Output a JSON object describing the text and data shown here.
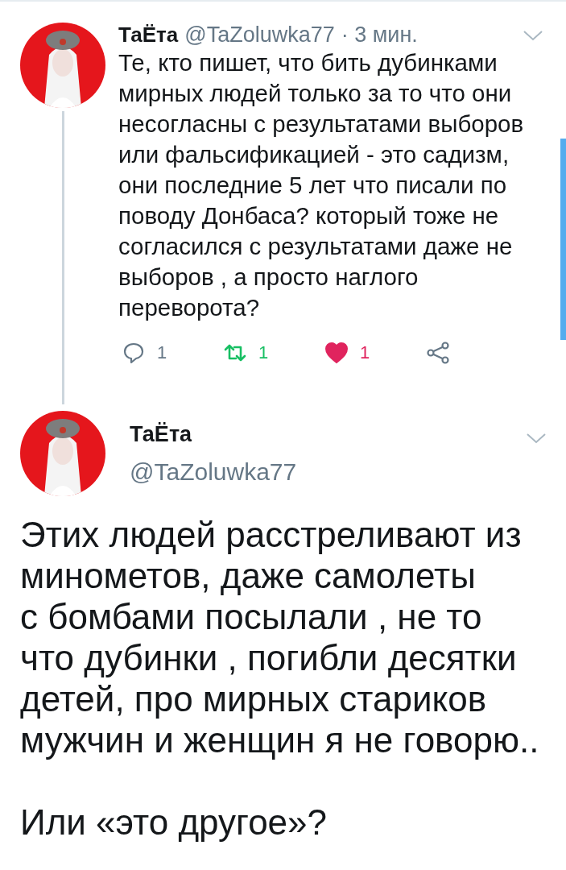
{
  "tweets": [
    {
      "kind": "compact",
      "name": "ТаЁта",
      "handle": "@TaZoluwka77",
      "time": "· 3 мин.",
      "text": "Те, кто пишет, что бить дубинками\nмирных людей только за то что они\nнесогласны с результатами выборов\nили фальсификацией - это садизм,\nони последние 5 лет что писали по\nповоду Донбаса? который тоже не\nсогласился с результатами даже не\nвыборов , а просто наглого\nпереворота?",
      "actions": [
        {
          "kind": "reply",
          "count": "1",
          "active": false
        },
        {
          "kind": "retweet",
          "count": "1",
          "active": true
        },
        {
          "kind": "like",
          "count": "1",
          "active": true
        },
        {
          "kind": "share",
          "active": false
        }
      ]
    },
    {
      "kind": "expanded",
      "name": "ТаЁта",
      "handle": "@TaZoluwka77",
      "paragraphs": [
        "Этих людей расстреливают из\nминометов, даже самолеты\nс бомбами посылали , не то\nчто дубинки , погибли десятки\nдетей, про мирных стариков\nмужчин и женщин я не говорю..",
        "Или «это другое»?"
      ]
    }
  ]
}
